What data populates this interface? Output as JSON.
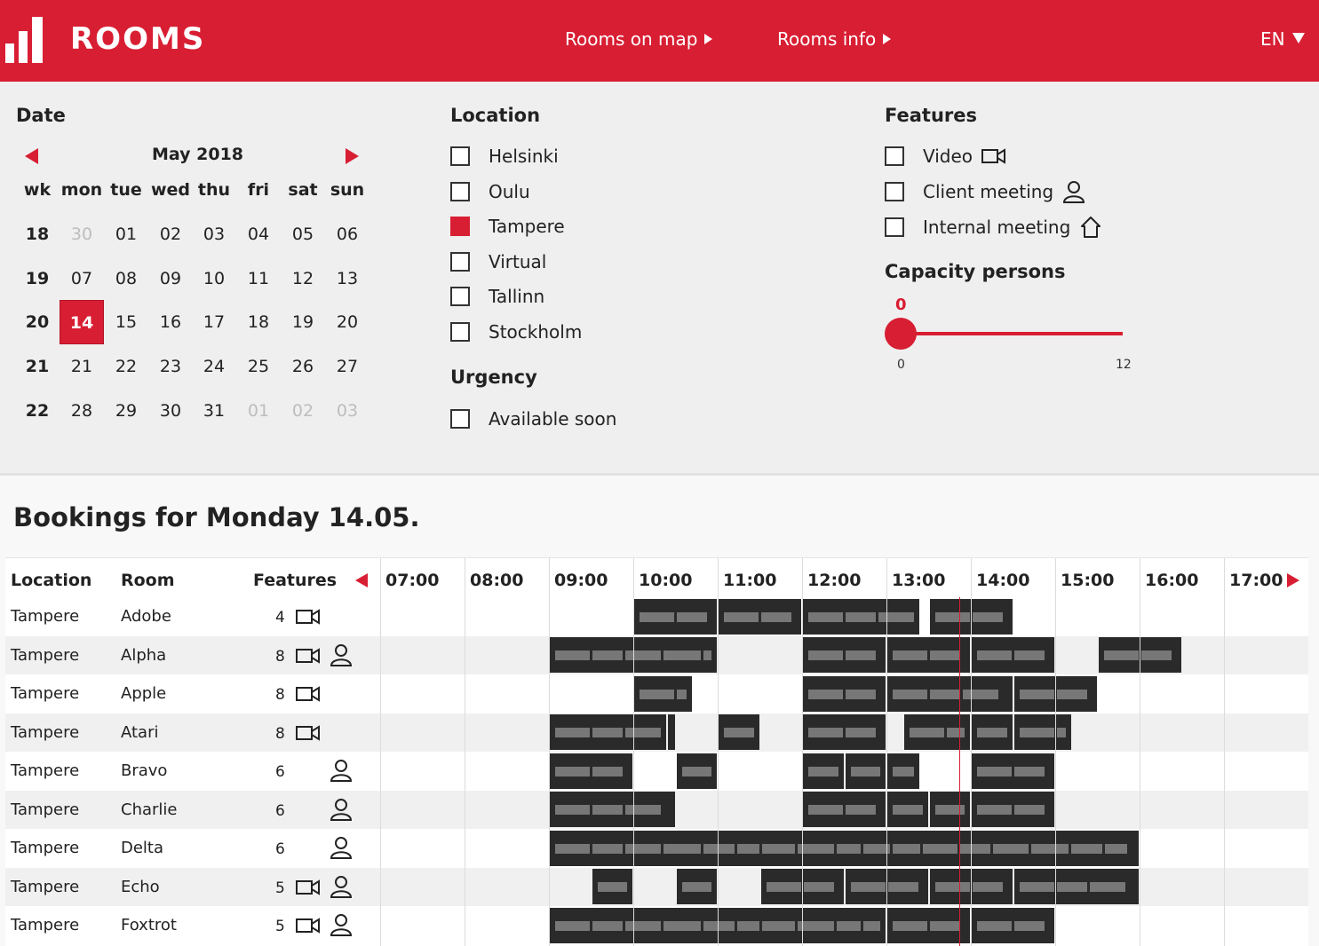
{
  "header": {
    "brand": "ROOMS",
    "nav": [
      {
        "label": "Rooms on map"
      },
      {
        "label": "Rooms info"
      }
    ],
    "language": "EN"
  },
  "date": {
    "title": "Date",
    "month": "May 2018",
    "headers": [
      "wk",
      "mon",
      "tue",
      "wed",
      "thu",
      "fri",
      "sat",
      "sun"
    ],
    "weeks": [
      {
        "wk": "18",
        "days": [
          "30",
          "01",
          "02",
          "03",
          "04",
          "05",
          "06"
        ],
        "muted": [
          true,
          false,
          false,
          false,
          false,
          false,
          false
        ]
      },
      {
        "wk": "19",
        "days": [
          "07",
          "08",
          "09",
          "10",
          "11",
          "12",
          "13"
        ],
        "muted": [
          false,
          false,
          false,
          false,
          false,
          false,
          false
        ]
      },
      {
        "wk": "20",
        "days": [
          "14",
          "15",
          "16",
          "17",
          "18",
          "19",
          "20"
        ],
        "muted": [
          false,
          false,
          false,
          false,
          false,
          false,
          false
        ]
      },
      {
        "wk": "21",
        "days": [
          "21",
          "22",
          "23",
          "24",
          "25",
          "26",
          "27"
        ],
        "muted": [
          false,
          false,
          false,
          false,
          false,
          false,
          false
        ]
      },
      {
        "wk": "22",
        "days": [
          "28",
          "29",
          "30",
          "31",
          "01",
          "02",
          "03"
        ],
        "muted": [
          false,
          false,
          false,
          false,
          true,
          true,
          true
        ]
      }
    ],
    "selected_day": "14",
    "accent": "#d81e33"
  },
  "location": {
    "title": "Location",
    "options": [
      {
        "label": "Helsinki",
        "checked": false
      },
      {
        "label": "Oulu",
        "checked": false
      },
      {
        "label": "Tampere",
        "checked": true
      },
      {
        "label": "Virtual",
        "checked": false
      },
      {
        "label": "Tallinn",
        "checked": false
      },
      {
        "label": "Stockholm",
        "checked": false
      }
    ]
  },
  "urgency": {
    "title": "Urgency",
    "options": [
      {
        "label": "Available soon",
        "checked": false
      }
    ]
  },
  "features": {
    "title": "Features",
    "options": [
      {
        "label": "Video",
        "icon": "video-icon",
        "checked": false
      },
      {
        "label": "Client meeting",
        "icon": "person-icon",
        "checked": false
      },
      {
        "label": "Internal meeting",
        "icon": "house-icon",
        "checked": false
      }
    ]
  },
  "capacity": {
    "title": "Capacity persons",
    "value": "0",
    "min": "0",
    "max": "12"
  },
  "bookings": {
    "title": "Bookings for Monday 14.05.",
    "columns": {
      "location": "Location",
      "room": "Room",
      "features": "Features"
    },
    "times": [
      "07:00",
      "08:00",
      "09:00",
      "10:00",
      "11:00",
      "12:00",
      "13:00",
      "14:00",
      "15:00",
      "16:00",
      "17:00"
    ],
    "rooms": [
      {
        "location": "Tampere",
        "room": "Adobe",
        "capacity": "4",
        "video": true,
        "client": false
      },
      {
        "location": "Tampere",
        "room": "Alpha",
        "capacity": "8",
        "video": true,
        "client": true
      },
      {
        "location": "Tampere",
        "room": "Apple",
        "capacity": "8",
        "video": true,
        "client": false
      },
      {
        "location": "Tampere",
        "room": "Atari",
        "capacity": "8",
        "video": true,
        "client": false
      },
      {
        "location": "Tampere",
        "room": "Bravo",
        "capacity": "6",
        "video": false,
        "client": true
      },
      {
        "location": "Tampere",
        "room": "Charlie",
        "capacity": "6",
        "video": false,
        "client": true
      },
      {
        "location": "Tampere",
        "room": "Delta",
        "capacity": "6",
        "video": false,
        "client": true
      },
      {
        "location": "Tampere",
        "room": "Echo",
        "capacity": "5",
        "video": true,
        "client": true
      },
      {
        "location": "Tampere",
        "room": "Foxtrot",
        "capacity": "5",
        "video": true,
        "client": true
      }
    ],
    "slots": [
      [
        [
          10.0,
          11.0
        ],
        [
          11.0,
          12.0
        ],
        [
          12.0,
          13.4
        ],
        [
          13.5,
          14.5
        ]
      ],
      [
        [
          9.0,
          11.0
        ],
        [
          12.0,
          13.0
        ],
        [
          13.0,
          14.0
        ],
        [
          14.0,
          15.0
        ],
        [
          15.5,
          16.5
        ]
      ],
      [
        [
          10.0,
          10.7
        ],
        [
          12.0,
          13.0
        ],
        [
          13.0,
          14.5
        ],
        [
          14.5,
          15.5
        ]
      ],
      [
        [
          9.0,
          10.4
        ],
        [
          10.4,
          10.5
        ],
        [
          11.0,
          11.5
        ],
        [
          12.0,
          13.0
        ],
        [
          13.2,
          14.0
        ],
        [
          14.0,
          14.5
        ],
        [
          14.5,
          15.2
        ]
      ],
      [
        [
          9.0,
          10.0
        ],
        [
          10.5,
          11.0
        ],
        [
          12.0,
          12.5
        ],
        [
          12.5,
          13.0
        ],
        [
          13.0,
          13.4
        ],
        [
          14.0,
          15.0
        ]
      ],
      [
        [
          9.0,
          10.5
        ],
        [
          12.0,
          13.0
        ],
        [
          13.0,
          13.5
        ],
        [
          13.5,
          14.0
        ],
        [
          14.0,
          15.0
        ]
      ],
      [
        [
          9.0,
          16.0
        ]
      ],
      [
        [
          9.5,
          10.0
        ],
        [
          10.5,
          11.0
        ],
        [
          11.5,
          12.5
        ],
        [
          12.5,
          13.5
        ],
        [
          13.5,
          14.5
        ],
        [
          14.5,
          16.0
        ]
      ],
      [
        [
          9.0,
          13.0
        ],
        [
          13.0,
          14.0
        ],
        [
          14.0,
          15.0
        ]
      ]
    ],
    "now_time": "13:30"
  }
}
